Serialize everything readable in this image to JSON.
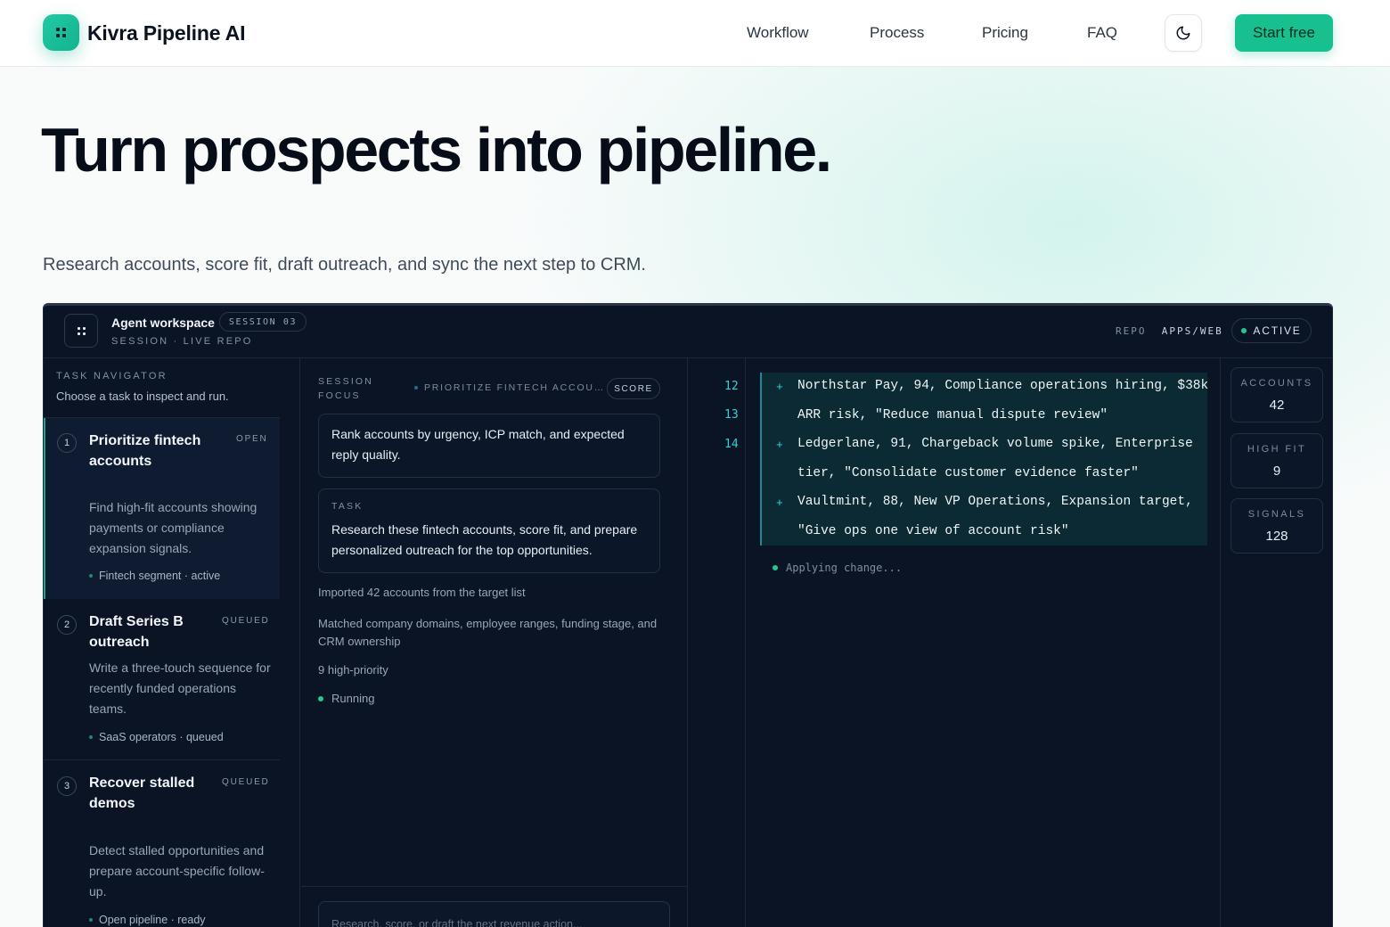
{
  "header": {
    "brand": "Kivra Pipeline AI",
    "nav": [
      "Workflow",
      "Process",
      "Pricing",
      "FAQ"
    ],
    "cta": "Start free",
    "theme_icon": "moon-icon",
    "logo_icon": "grid-dots-icon"
  },
  "hero": {
    "title": "Turn prospects into pipeline.",
    "subtitle": "Research accounts, score fit, draft outreach, and sync the next step to CRM."
  },
  "workspace": {
    "title": "Agent workspace",
    "session_pill": "SESSION 03",
    "subline": "SESSION · LIVE REPO",
    "repo_label": "REPO",
    "repo_value": "APPS/WEB",
    "status": "ACTIVE",
    "colors": {
      "accent": "#18c08f",
      "panel": "#0a1425",
      "diff_bg": "#0c2a33",
      "line_number": "#2fd1d8"
    }
  },
  "navigator": {
    "heading": "TASK NAVIGATOR",
    "hint": "Choose a task to inspect and run.",
    "tasks": [
      {
        "num": "1",
        "title": "Prioritize fintech accounts",
        "status": "OPEN",
        "desc": "Find high-fit accounts showing payments or compliance expansion signals.",
        "tag": "Fintech segment · active"
      },
      {
        "num": "2",
        "title": "Draft Series B outreach",
        "status": "QUEUED",
        "desc": "Write a three-touch sequence for recently funded operations teams.",
        "tag": "SaaS operators · queued"
      },
      {
        "num": "3",
        "title": "Recover stalled demos",
        "status": "QUEUED",
        "desc": "Detect stalled opportunities and prepare account-specific follow-up.",
        "tag": "Open pipeline · ready"
      }
    ]
  },
  "focus": {
    "label": "SESSION FOCUS",
    "crumb": "PRIORITIZE FINTECH ACCOU…",
    "mode_pill": "SCORE",
    "focus_text": "Rank accounts by urgency, ICP match, and expected reply quality.",
    "task_label": "TASK",
    "task_text": "Research these fintech accounts, score fit, and prepare personalized outreach for the top opportunities.",
    "log": [
      "Imported 42 accounts from the target list",
      "Matched company domains, employee ranges, funding stage, and CRM ownership",
      "9 high-priority"
    ],
    "running": "Running",
    "composer_placeholder": "Research, score, or draft the next revenue action..."
  },
  "code": {
    "line_numbers": [
      "12",
      "13",
      "14"
    ],
    "lines": [
      {
        "plus": "+",
        "text": "Northstar Pay, 94, Compliance operations hiring, $38k"
      },
      {
        "plus": "",
        "text": "ARR risk, \"Reduce manual dispute review\""
      },
      {
        "plus": "+",
        "text": "Ledgerlane, 91, Chargeback volume spike, Enterprise"
      },
      {
        "plus": "",
        "text": "tier, \"Consolidate customer evidence faster\""
      },
      {
        "plus": "+",
        "text": "Vaultmint, 88, New VP Operations, Expansion target,"
      },
      {
        "plus": "",
        "text": "\"Give ops one view of account risk\""
      }
    ],
    "applying": "Applying change..."
  },
  "stats": [
    {
      "label": "ACCOUNTS",
      "value": "42"
    },
    {
      "label": "HIGH FIT",
      "value": "9"
    },
    {
      "label": "SIGNALS",
      "value": "128"
    }
  ]
}
